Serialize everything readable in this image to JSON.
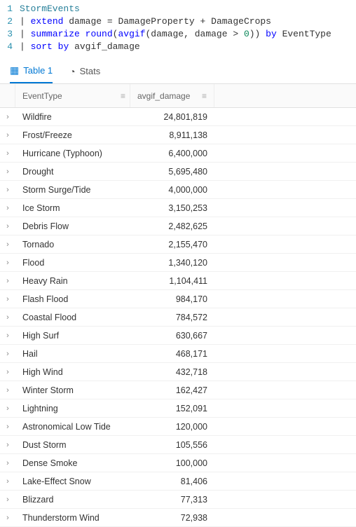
{
  "editor": {
    "lines": [
      {
        "num": "1",
        "html": "<span class='tbl'>StormEvents</span>"
      },
      {
        "num": "2",
        "html": "<span class='pipe'>|</span> <span class='kw'>extend</span> <span>damage</span> <span>=</span> <span>DamageProperty</span> <span>+</span> <span>DamageCrops</span>"
      },
      {
        "num": "3",
        "html": "<span class='pipe'>|</span> <span class='kw'>summarize</span> <span class='fn'>round</span>(<span class='fn'>avgif</span>(damage, damage &gt; <span class='green'>0</span>)) <span class='kw'>by</span> <span>EventType</span>"
      },
      {
        "num": "4",
        "html": "<span class='pipe'>|</span> <span class='kw'>sort</span> <span class='kw'>by</span> <span>avgif_damage</span>"
      }
    ]
  },
  "tabs": {
    "table": "Table 1",
    "stats": "Stats"
  },
  "columns": {
    "event": "EventType",
    "damage": "avgif_damage"
  },
  "rows": [
    {
      "event": "Wildfire",
      "damage": "24,801,819"
    },
    {
      "event": "Frost/Freeze",
      "damage": "8,911,138"
    },
    {
      "event": "Hurricane (Typhoon)",
      "damage": "6,400,000"
    },
    {
      "event": "Drought",
      "damage": "5,695,480"
    },
    {
      "event": "Storm Surge/Tide",
      "damage": "4,000,000"
    },
    {
      "event": "Ice Storm",
      "damage": "3,150,253"
    },
    {
      "event": "Debris Flow",
      "damage": "2,482,625"
    },
    {
      "event": "Tornado",
      "damage": "2,155,470"
    },
    {
      "event": "Flood",
      "damage": "1,340,120"
    },
    {
      "event": "Heavy Rain",
      "damage": "1,104,411"
    },
    {
      "event": "Flash Flood",
      "damage": "984,170"
    },
    {
      "event": "Coastal Flood",
      "damage": "784,572"
    },
    {
      "event": "High Surf",
      "damage": "630,667"
    },
    {
      "event": "Hail",
      "damage": "468,171"
    },
    {
      "event": "High Wind",
      "damage": "432,718"
    },
    {
      "event": "Winter Storm",
      "damage": "162,427"
    },
    {
      "event": "Lightning",
      "damage": "152,091"
    },
    {
      "event": "Astronomical Low Tide",
      "damage": "120,000"
    },
    {
      "event": "Dust Storm",
      "damage": "105,556"
    },
    {
      "event": "Dense Smoke",
      "damage": "100,000"
    },
    {
      "event": "Lake-Effect Snow",
      "damage": "81,406"
    },
    {
      "event": "Blizzard",
      "damage": "77,313"
    },
    {
      "event": "Thunderstorm Wind",
      "damage": "72,938"
    }
  ]
}
